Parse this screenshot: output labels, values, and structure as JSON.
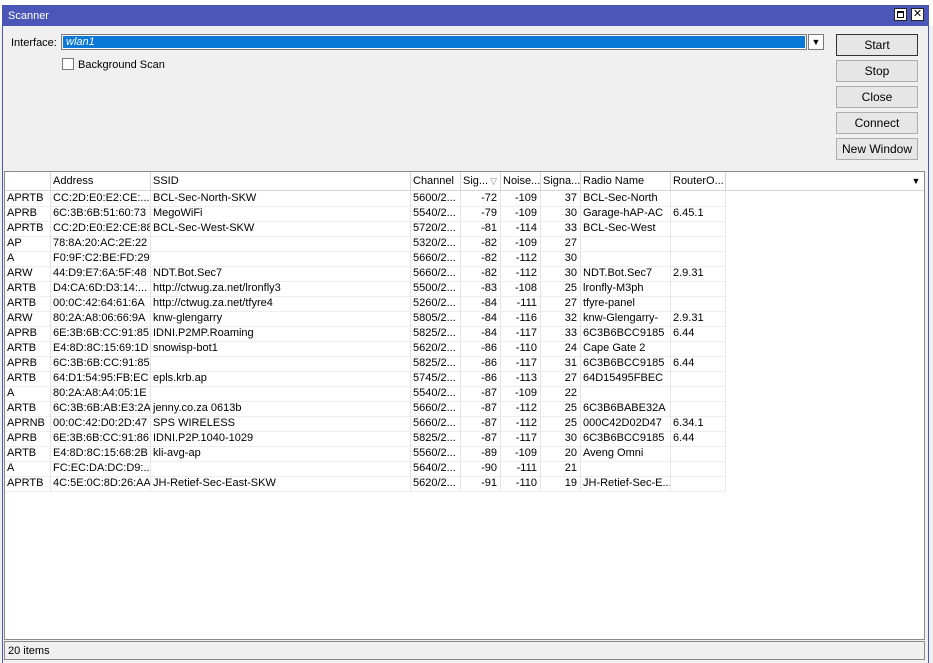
{
  "window": {
    "title": "Scanner"
  },
  "interface": {
    "label": "Interface:",
    "value": "wlan1"
  },
  "background_scan": {
    "label": "Background Scan",
    "checked": false
  },
  "buttons": {
    "start": "Start",
    "stop": "Stop",
    "close": "Close",
    "connect": "Connect",
    "new_window": "New Window"
  },
  "columns": [
    "",
    "Address",
    "SSID",
    "Channel",
    "Sig...",
    "Noise...",
    "Signa...",
    "Radio Name",
    "RouterO..."
  ],
  "rows": [
    [
      "APRTB",
      "CC:2D:E0:E2:CE:...",
      "BCL-Sec-North-SKW",
      "5600/2...",
      "-72",
      "-109",
      "37",
      "BCL-Sec-North",
      ""
    ],
    [
      "APRB",
      "6C:3B:6B:51:60:73",
      "MegoWiFi",
      "5540/2...",
      "-79",
      "-109",
      "30",
      "Garage-hAP-AC",
      "6.45.1"
    ],
    [
      "APRTB",
      "CC:2D:E0:E2:CE:88",
      "BCL-Sec-West-SKW",
      "5720/2...",
      "-81",
      "-114",
      "33",
      "BCL-Sec-West",
      ""
    ],
    [
      "AP",
      "78:8A:20:AC:2E:22",
      "",
      "5320/2...",
      "-82",
      "-109",
      "27",
      "",
      ""
    ],
    [
      "A",
      "F0:9F:C2:BE:FD:29",
      "",
      "5660/2...",
      "-82",
      "-112",
      "30",
      "",
      ""
    ],
    [
      "ARW",
      "44:D9:E7:6A:5F:48",
      "NDT.Bot.Sec7",
      "5660/2...",
      "-82",
      "-112",
      "30",
      "NDT.Bot.Sec7",
      "2.9.31"
    ],
    [
      "ARTB",
      "D4:CA:6D:D3:14:...",
      "http://ctwug.za.net/lronfly3",
      "5500/2...",
      "-83",
      "-108",
      "25",
      "lronfly-M3ph",
      ""
    ],
    [
      "ARTB",
      "00:0C:42:64:61:6A",
      "http://ctwug.za.net/tfyre4",
      "5260/2...",
      "-84",
      "-111",
      "27",
      "tfyre-panel",
      ""
    ],
    [
      "ARW",
      "80:2A:A8:06:66:9A",
      "knw-glengarry",
      "5805/2...",
      "-84",
      "-116",
      "32",
      "knw-Glengarry-",
      "2.9.31"
    ],
    [
      "APRB",
      "6E:3B:6B:CC:91:85",
      "IDNI.P2MP.Roaming",
      "5825/2...",
      "-84",
      "-117",
      "33",
      "6C3B6BCC9185",
      "6.44"
    ],
    [
      "ARTB",
      "E4:8D:8C:15:69:1D",
      "snowisp-bot1",
      "5620/2...",
      "-86",
      "-110",
      "24",
      "Cape Gate 2",
      ""
    ],
    [
      "APRB",
      "6C:3B:6B:CC:91:85",
      "",
      "5825/2...",
      "-86",
      "-117",
      "31",
      "6C3B6BCC9185",
      "6.44"
    ],
    [
      "ARTB",
      "64:D1:54:95:FB:EC",
      "epls.krb.ap",
      "5745/2...",
      "-86",
      "-113",
      "27",
      "64D15495FBEC",
      ""
    ],
    [
      "A",
      "80:2A:A8:A4:05:1E",
      "",
      "5540/2...",
      "-87",
      "-109",
      "22",
      "",
      ""
    ],
    [
      "ARTB",
      "6C:3B:6B:AB:E3:2A",
      "jenny.co.za 0613b",
      "5660/2...",
      "-87",
      "-112",
      "25",
      "6C3B6BABE32A",
      ""
    ],
    [
      "APRNB",
      "00:0C:42:D0:2D:47",
      "SPS WIRELESS",
      "5660/2...",
      "-87",
      "-112",
      "25",
      "000C42D02D47",
      "6.34.1"
    ],
    [
      "APRB",
      "6E:3B:6B:CC:91:86",
      "IDNI.P2P.1040-1029",
      "5825/2...",
      "-87",
      "-117",
      "30",
      "6C3B6BCC9185",
      "6.44"
    ],
    [
      "ARTB",
      "E4:8D:8C:15:68:2B",
      "kli-avg-ap",
      "5560/2...",
      "-89",
      "-109",
      "20",
      "Aveng Omni",
      ""
    ],
    [
      "A",
      "FC:EC:DA:DC:D9:...",
      "",
      "5640/2...",
      "-90",
      "-111",
      "21",
      "",
      ""
    ],
    [
      "APRTB",
      "4C:5E:0C:8D:26:AA",
      "JH-Retief-Sec-East-SKW",
      "5620/2...",
      "-91",
      "-110",
      "19",
      "JH-Retief-Sec-E...",
      ""
    ]
  ],
  "status": {
    "count": "20 items"
  },
  "icons": {
    "sort": "sort-desc-icon",
    "menu": "column-menu-icon"
  }
}
